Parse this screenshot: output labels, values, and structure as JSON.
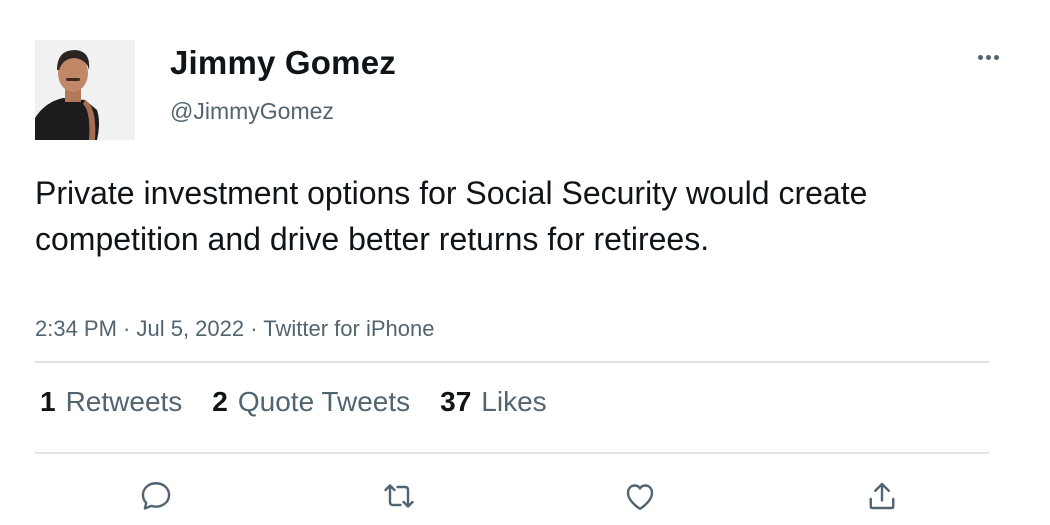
{
  "author": {
    "display_name": "Jimmy Gomez",
    "handle": "@JimmyGomez",
    "avatar_icon": "profile-photo"
  },
  "more_icon": "ellipsis-icon",
  "tweet": {
    "text": "Private investment options for Social Security would create competition and drive better returns for retirees.",
    "meta": "2:34 PM · Jul 5, 2022 · Twitter for iPhone"
  },
  "stats": {
    "retweets_count": "1",
    "retweets_label": "Retweets",
    "quotes_count": "2",
    "quotes_label": "Quote Tweets",
    "likes_count": "37",
    "likes_label": "Likes"
  },
  "actions": [
    "reply-icon",
    "retweet-icon",
    "like-icon",
    "share-icon"
  ],
  "colors": {
    "text_primary": "#0f1419",
    "text_secondary": "#536471",
    "divider": "#e1e4e6"
  }
}
